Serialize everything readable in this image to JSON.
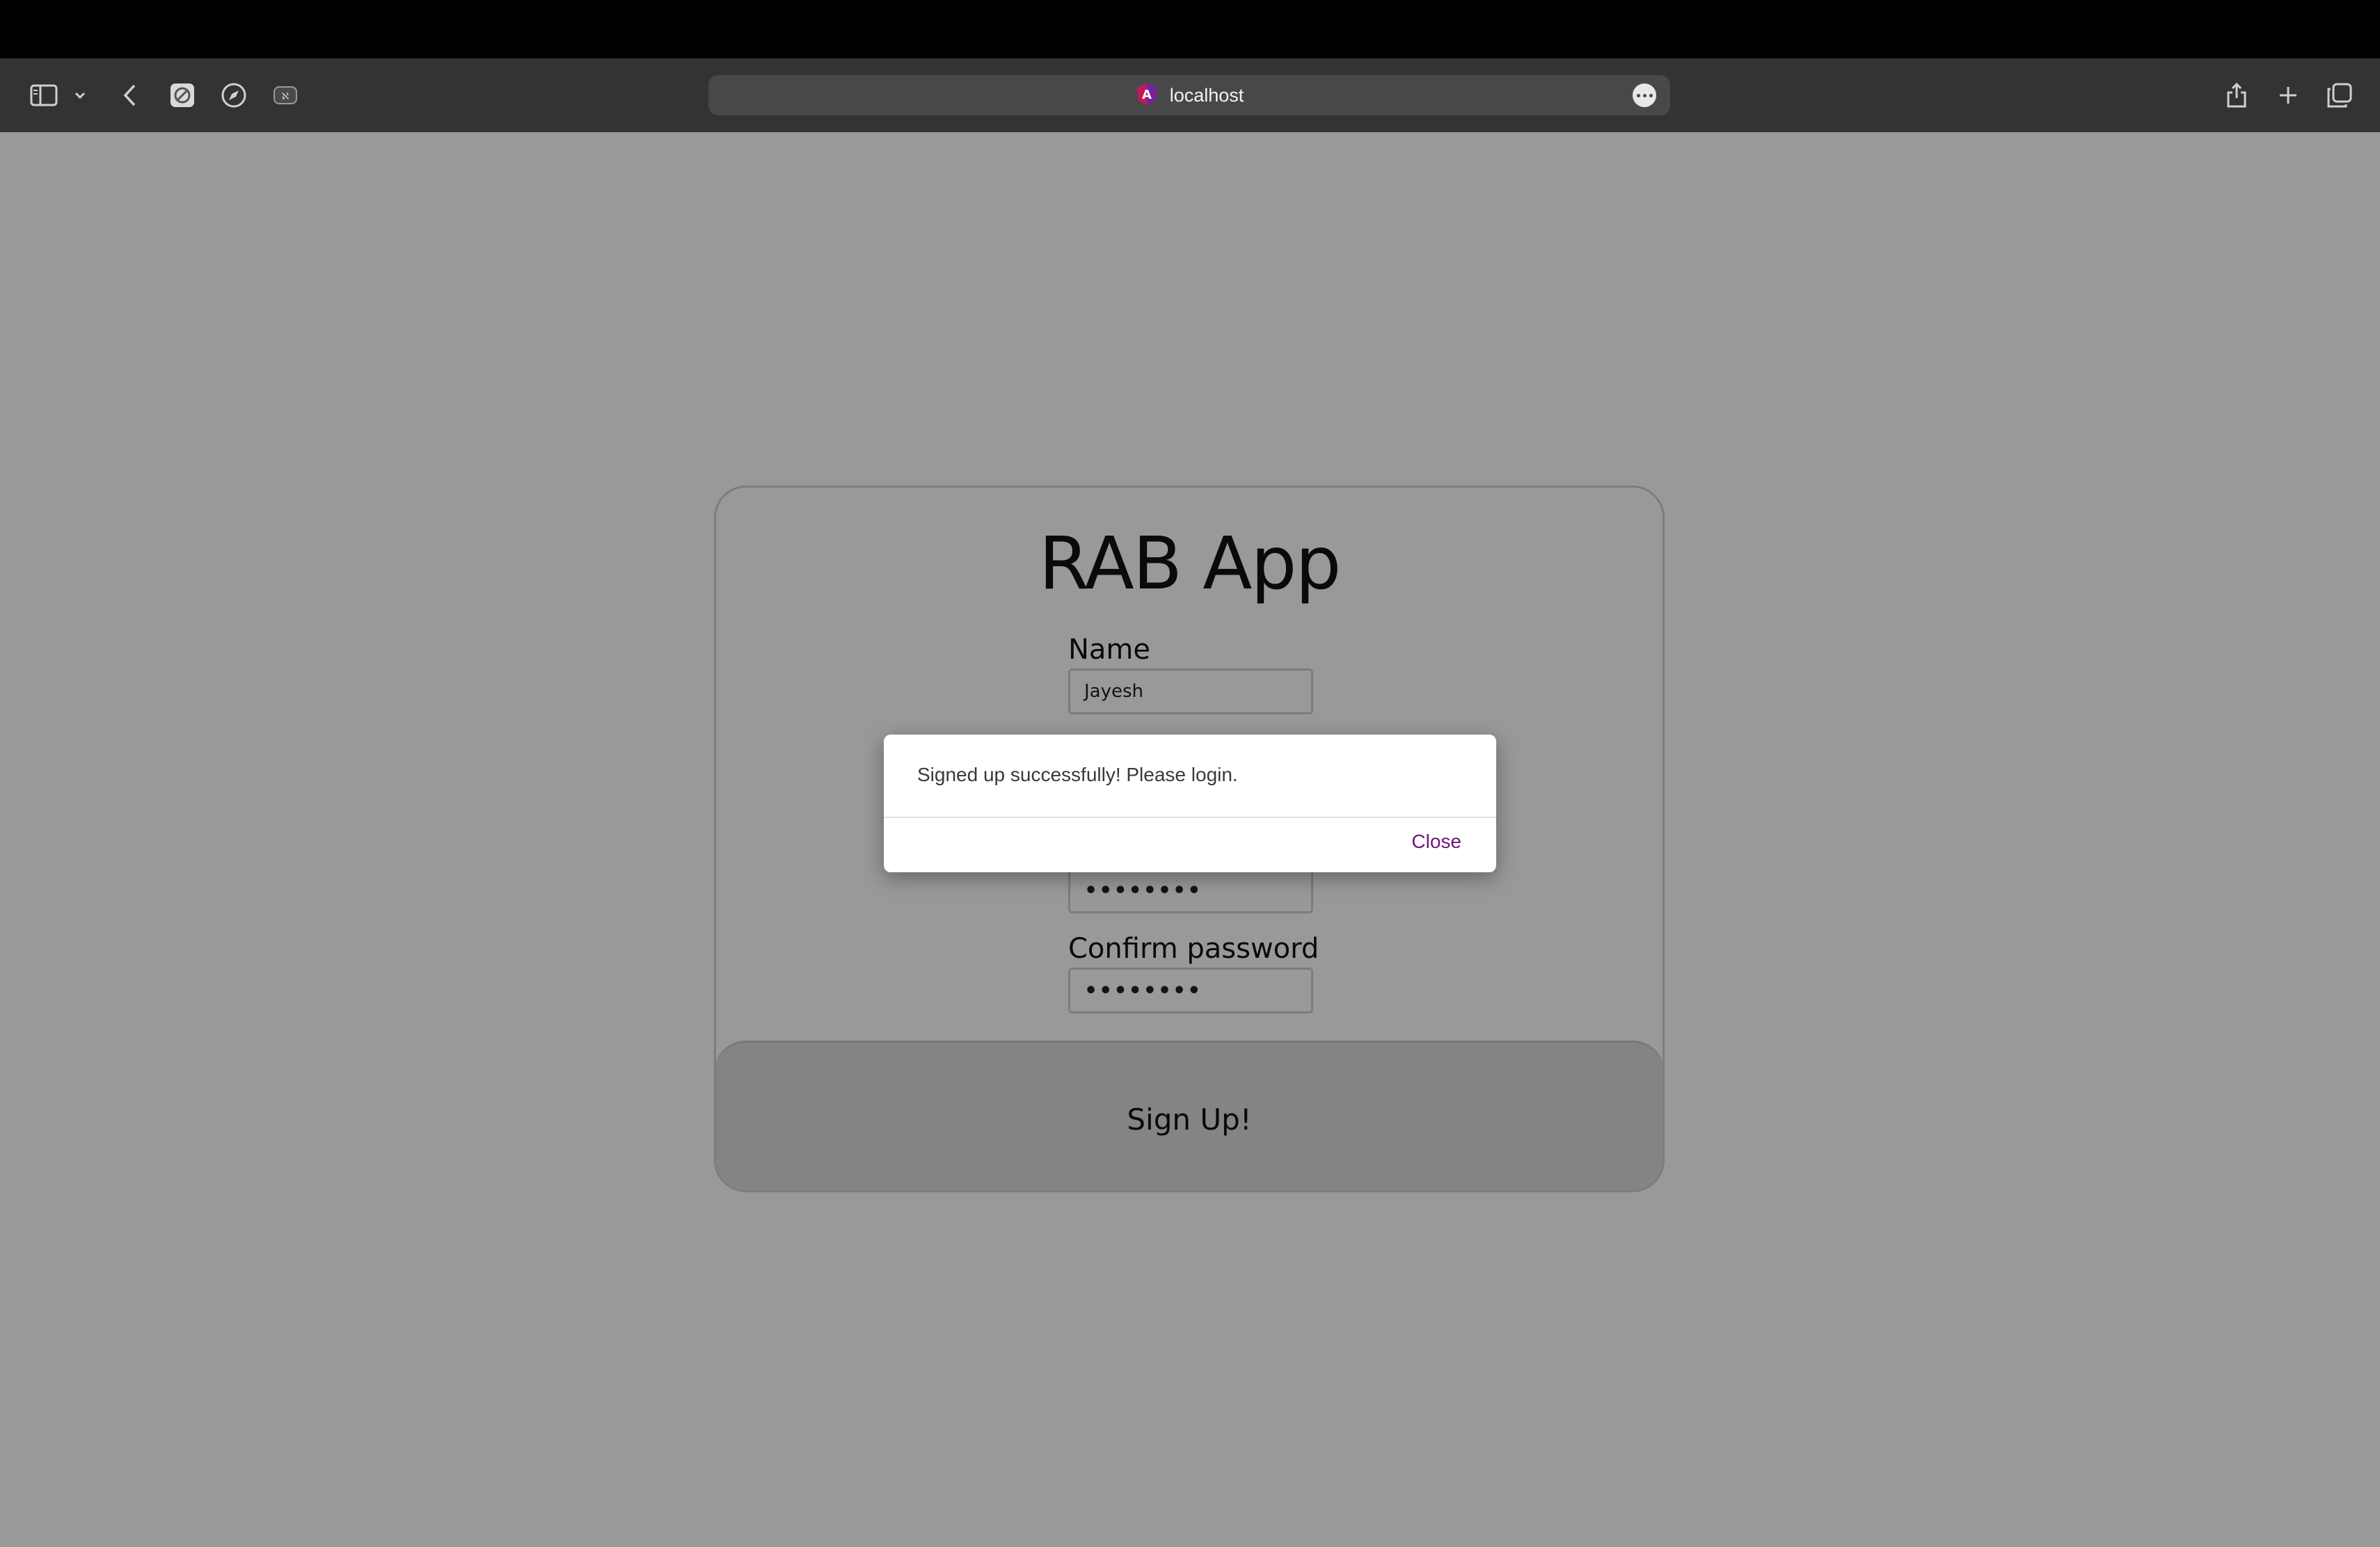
{
  "browser": {
    "url": "localhost",
    "icons": [
      "sidebar-icon",
      "chevron-down-icon",
      "back-arrow-icon",
      "extension-icon",
      "compass-icon",
      "privacy-icon",
      "site-favicon",
      "more-icon",
      "share-icon",
      "plus-icon",
      "tabs-icon"
    ]
  },
  "app": {
    "title": "RAB App",
    "fields": {
      "name_label": "Name",
      "name_value": "Jayesh",
      "password_value": "••••••••",
      "confirm_label": "Confirm password",
      "confirm_value": "••••••••"
    },
    "signup_button": "Sign Up!"
  },
  "dialog": {
    "message": "Signed up successfully! Please login.",
    "close_label": "Close",
    "close_color": "#6a1b7a"
  }
}
